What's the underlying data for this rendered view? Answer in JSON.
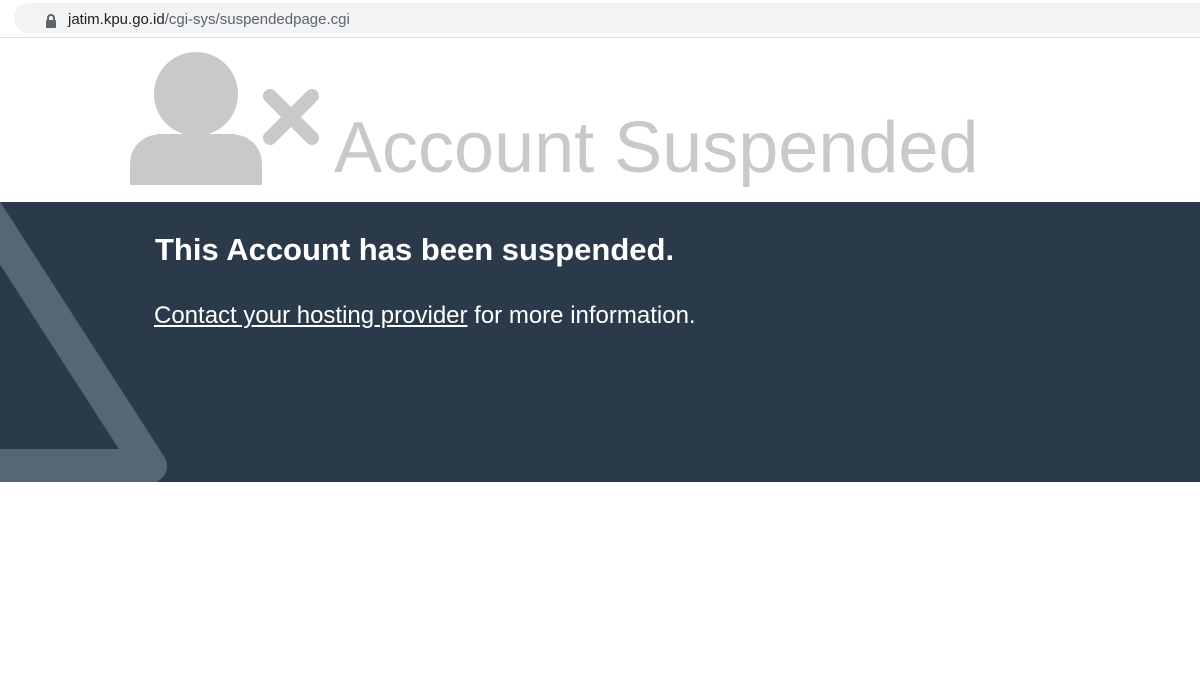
{
  "browser": {
    "url_host": "jatim.kpu.go.id",
    "url_path": "/cgi-sys/suspendedpage.cgi",
    "lock_icon": "lock-icon"
  },
  "header": {
    "title": "Account Suspended",
    "icons": [
      "user-icon",
      "close-icon"
    ],
    "title_color": "#c9c9c9"
  },
  "banner": {
    "heading": "This Account has been suspended.",
    "link_text": "Contact your hosting provider",
    "message_suffix": " for more information.",
    "background_color": "#2a3a4b",
    "icon": "warning-triangle-icon"
  }
}
